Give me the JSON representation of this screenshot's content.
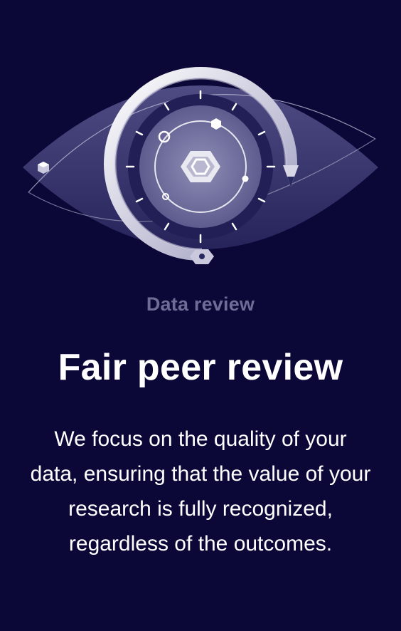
{
  "hero": {
    "illustration_icon": "eye-icon",
    "center_icon": "hexagon-icon",
    "accent_colors": {
      "background": "#0b0838",
      "eye": "#3a3870",
      "iris": "#7b7aa6",
      "highlight": "#e8e8ef"
    }
  },
  "section": {
    "eyebrow": "Data review",
    "title": "Fair peer review",
    "description": "We focus on the quality of your data, ensuring that the value of your research is fully recognized, regardless of the outcomes."
  }
}
